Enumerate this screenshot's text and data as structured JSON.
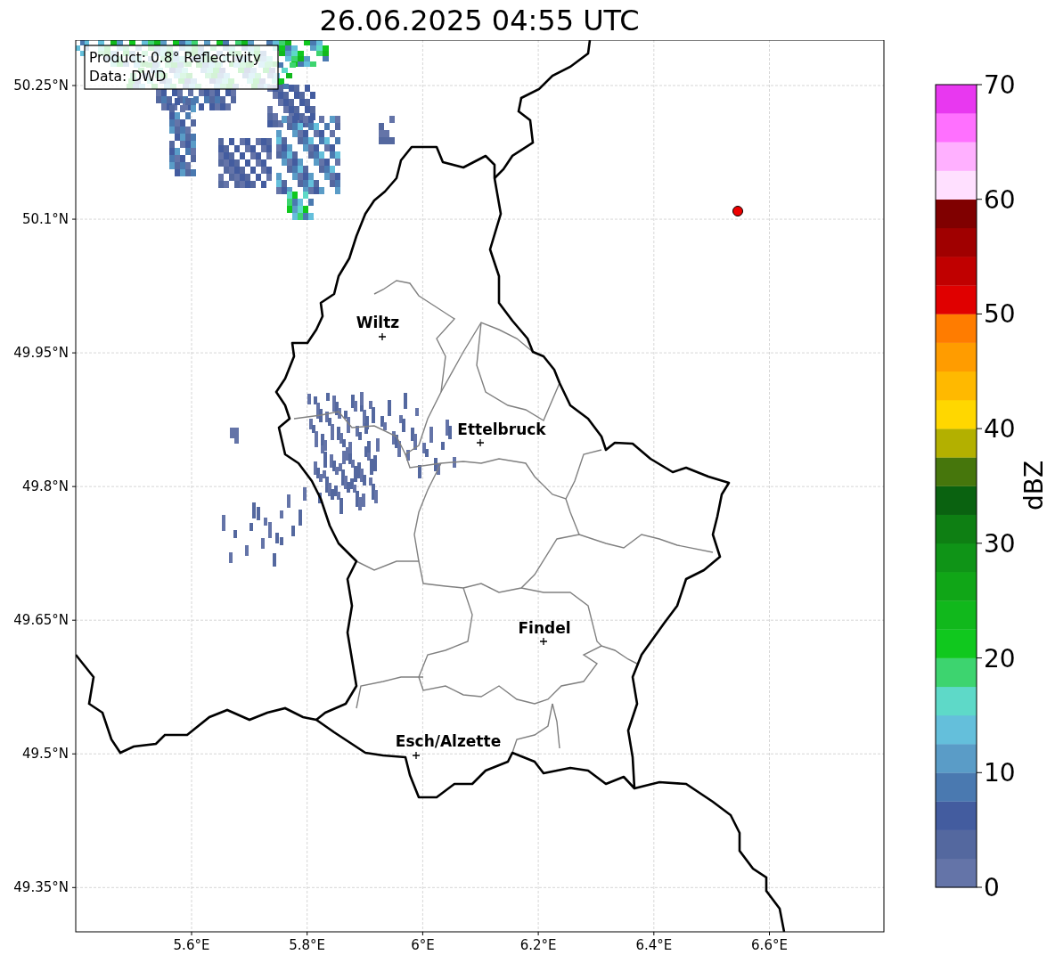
{
  "title": "26.06.2025 04:55 UTC",
  "info": [
    "Product: 0.8° Reflectivity",
    "Data: DWD"
  ],
  "lat_ticks": [
    "50.25°N",
    "50.1°N",
    "49.95°N",
    "49.8°N",
    "49.65°N",
    "49.5°N",
    "49.35°N"
  ],
  "lon_ticks": [
    "5.6°E",
    "5.8°E",
    "6°E",
    "6.2°E",
    "6.4°E",
    "6.6°E"
  ],
  "cities": [
    "Wiltz",
    "Ettelbruck",
    "Findel",
    "Esch/Alzette"
  ],
  "colorbar": {
    "label": "dBZ",
    "ticks": [
      "70",
      "60",
      "50",
      "40",
      "30",
      "20",
      "10",
      "0"
    ],
    "bins": [
      {
        "color": "#6474a8"
      },
      {
        "color": "#54689f"
      },
      {
        "color": "#435c9f"
      },
      {
        "color": "#4a79b0"
      },
      {
        "color": "#5a9cc7"
      },
      {
        "color": "#64bfdb"
      },
      {
        "color": "#5ed9c8"
      },
      {
        "color": "#3dd46f"
      },
      {
        "color": "#10c81e"
      },
      {
        "color": "#11b81c"
      },
      {
        "color": "#10a617"
      },
      {
        "color": "#0f9417"
      },
      {
        "color": "#0e7f13"
      },
      {
        "color": "#0a6210"
      },
      {
        "color": "#46760c"
      },
      {
        "color": "#b3b000"
      },
      {
        "color": "#ffd700"
      },
      {
        "color": "#ffb900"
      },
      {
        "color": "#ff9c00"
      },
      {
        "color": "#ff7c00"
      },
      {
        "color": "#e00000"
      },
      {
        "color": "#c00000"
      },
      {
        "color": "#a00000"
      },
      {
        "color": "#800000"
      },
      {
        "color": "#ffe0ff"
      },
      {
        "color": "#ffb0ff"
      },
      {
        "color": "#ff70ff"
      },
      {
        "color": "#e838f0"
      }
    ]
  }
}
